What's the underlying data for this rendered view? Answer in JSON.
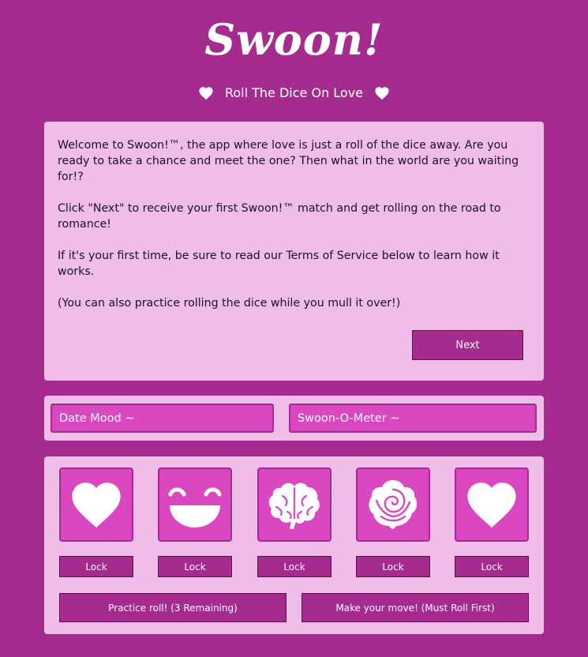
{
  "header": {
    "logo_text": "Swoon!",
    "tagline": "Roll The Dice On Love",
    "tagline_icon": "heart-icon"
  },
  "welcome": {
    "paragraphs": [
      "Welcome to Swoon!™, the app where love is just a roll of the dice away. Are you ready to take a chance and meet the one? Then what in the world are you waiting for!?",
      "Click \"Next\" to receive your first Swoon!™ match and get rolling on the road to romance!",
      "If it's your first time, be sure to read our Terms of Service below to learn how it works.",
      "(You can also practice rolling the dice while you mull it over!)"
    ],
    "next_label": "Next"
  },
  "meters": {
    "date_mood": "Date Mood ~",
    "swoon_o_meter": "Swoon-O-Meter ~"
  },
  "dice": [
    {
      "icon": "heart-icon",
      "lock_label": "Lock"
    },
    {
      "icon": "smile-icon",
      "lock_label": "Lock"
    },
    {
      "icon": "brain-icon",
      "lock_label": "Lock"
    },
    {
      "icon": "rose-icon",
      "lock_label": "Lock"
    },
    {
      "icon": "heart-icon",
      "lock_label": "Lock"
    }
  ],
  "actions": {
    "practice_label": "Practice roll! (3 Remaining)",
    "move_label": "Make your move! (Must Roll First)"
  },
  "colors": {
    "background": "#a52b8e",
    "panel": "#f0bde9",
    "die_face": "#d948c1",
    "button": "#a52b8e",
    "text": "#ffffff"
  }
}
